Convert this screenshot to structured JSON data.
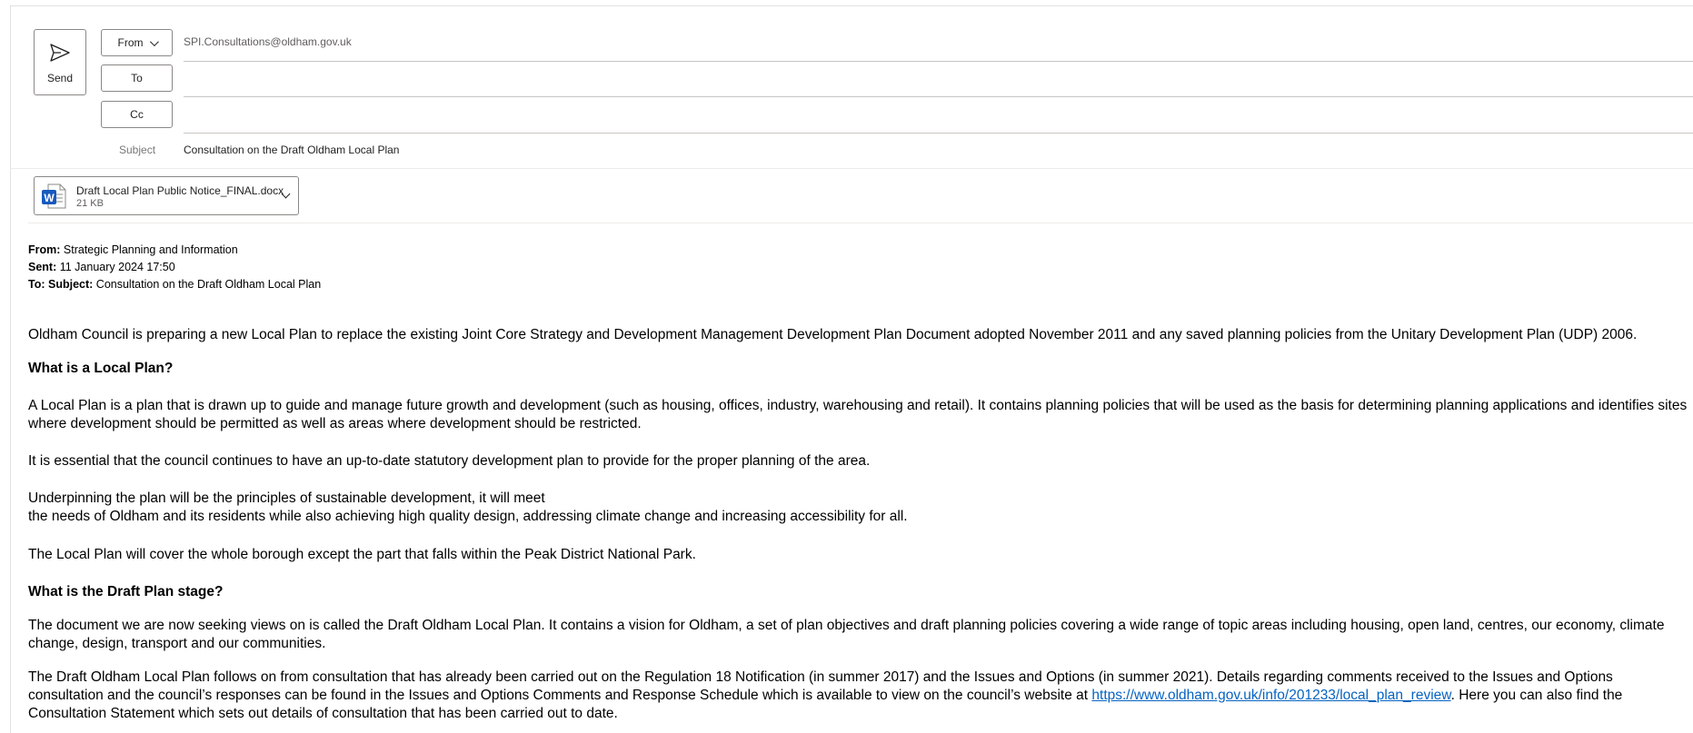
{
  "compose": {
    "send_label": "Send",
    "from_label": "From",
    "from_address": "SPI.Consultations@oldham.gov.uk",
    "to_label": "To",
    "cc_label": "Cc",
    "subject_label": "Subject",
    "subject_value": "Consultation on the Draft Oldham Local Plan"
  },
  "attachment": {
    "name": "Draft Local Plan Public Notice_FINAL.docx",
    "size": "21 KB",
    "icon": "word-doc-icon",
    "icon_letter": "W"
  },
  "forwarded": {
    "from_label": "From:",
    "from_value": "Strategic Planning and Information",
    "sent_label": "Sent:",
    "sent_value": "11 January 2024 17:50",
    "to_label": "To:",
    "subject_label": "Subject:",
    "subject_value": "Consultation on the Draft Oldham Local Plan"
  },
  "body": {
    "p1": "Oldham Council is preparing a new Local Plan to replace the existing Joint Core Strategy and Development Management Development Plan Document adopted November 2011 and any saved planning policies from the Unitary Development Plan (UDP) 2006.",
    "h1": "What is a Local Plan?",
    "p2": "A Local Plan is a plan that is drawn up to guide and manage future growth and development (such as housing, offices, industry, warehousing and retail). It contains planning policies that will be used as the basis for determining planning applications and identifies sites where development should be permitted as well as areas where development should be restricted.",
    "p3": "It is essential that the council continues to have an up-to-date statutory development plan to provide for the proper planning of the area.",
    "p4a": "Underpinning the plan will be the principles of sustainable development, it will meet",
    "p4b": "the needs of Oldham and its residents while also achieving high quality design, addressing climate change and increasing accessibility for all.",
    "p5": "The Local Plan will cover the whole borough except the part that falls within the Peak District National Park.",
    "h2": "What is the Draft Plan stage?",
    "p6": "The document we are now seeking views on is called the Draft Oldham Local Plan. It contains a vision for Oldham, a set of plan objectives and draft planning policies covering a wide range of topic areas including housing, open land, centres, our economy, climate change, design, transport and our communities.",
    "p7_before": "The Draft Oldham Local Plan follows on from consultation that has already been carried out on the Regulation 18 Notification (in summer 2017) and the Issues and Options (in summer 2021). Details regarding comments received to the Issues and Options consultation and the council’s responses can be found in the Issues and Options Comments and Response Schedule which is available to view on the council’s website at ",
    "p7_link": "https://www.oldham.gov.uk/info/201233/local_plan_review",
    "p7_after": ". Here you can also find the Consultation Statement which sets out details of consultation that has been carried out to date."
  },
  "colors": {
    "border": "#8a8886",
    "link": "#0563c1",
    "word_blue": "#185abd"
  }
}
